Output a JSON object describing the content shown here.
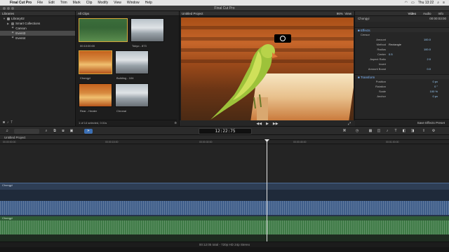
{
  "menubar": {
    "app_name": "Final Cut Pro",
    "items": [
      "File",
      "Edit",
      "Trim",
      "Mark",
      "Clip",
      "Modify",
      "View",
      "Window",
      "Help"
    ],
    "clock": "Thu 13:22"
  },
  "window": {
    "title": "Final Cut Pro"
  },
  "libraries": {
    "header": "Libraries",
    "items": [
      {
        "label": "Library02",
        "icon": "star-icon"
      },
      {
        "label": "Smart Collections",
        "icon": "folder-icon"
      },
      {
        "label": "Canson",
        "icon": "star-icon"
      },
      {
        "label": "Event3",
        "icon": "star-icon"
      },
      {
        "label": "Event4",
        "icon": "star-icon"
      }
    ]
  },
  "browser": {
    "header": "All Clips",
    "clips": [
      {
        "caption": "00:10:00:00"
      },
      {
        "caption": "Tokyo - 873"
      },
      {
        "caption": "Chongyi"
      },
      {
        "caption": "Building - 104"
      },
      {
        "caption": "Rear - Heater"
      },
      {
        "caption": "Chronai"
      }
    ],
    "status": "1 of 14 selected, 0:31s"
  },
  "viewer": {
    "title": "Untitled Project",
    "zoom": "96%",
    "view_label": "View"
  },
  "inspector": {
    "tabs": [
      "Video",
      "Audio",
      "Info"
    ],
    "clip_name": "Chongyi",
    "duration": "00:00:03:00",
    "sections": [
      {
        "title": "Effects",
        "rows": [
          {
            "label": "Censor",
            "value": ""
          },
          {
            "label": "Amount",
            "value": "100.0"
          },
          {
            "label": "Method",
            "value": "Rectangle"
          },
          {
            "label": "Radius",
            "value": "100.0"
          },
          {
            "label": "Center",
            "value": "0.5"
          },
          {
            "label": "Aspect Ratio",
            "value": "2.0"
          },
          {
            "label": "Invert",
            "value": ""
          },
          {
            "label": "Amount Boost",
            "value": "0.0"
          }
        ]
      },
      {
        "title": "Transform",
        "rows": [
          {
            "label": "Position",
            "value": "0 px"
          },
          {
            "label": "Rotation",
            "value": "0 °"
          },
          {
            "label": "Scale",
            "value": "100 %"
          },
          {
            "label": "Anchor",
            "value": "0 px"
          }
        ]
      }
    ],
    "save_preset": "Save Effects Preset"
  },
  "toolbar": {
    "timecode": "12:22:75"
  },
  "timeline": {
    "project": "Untitled Project",
    "ruler_ticks": [
      "00:00:00:00",
      "00:00:15:00",
      "00:00:30:00",
      "00:00:45:00",
      "00:01:00:00"
    ],
    "clip_labels": [
      "Chongyi",
      "Chongyi"
    ],
    "status": "00:12:05 total - 720p HD 24p Stereo"
  }
}
